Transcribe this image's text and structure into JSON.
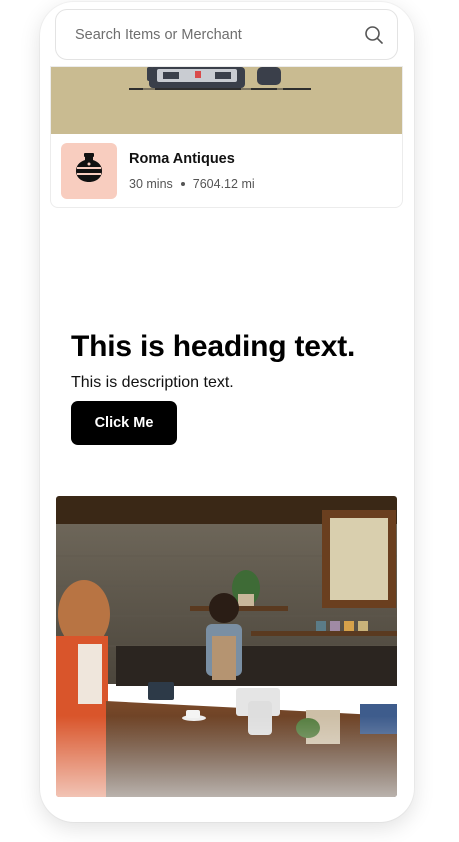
{
  "search": {
    "placeholder": "Search Items or Merchant",
    "icon": "search-icon"
  },
  "merchant": {
    "name": "Roma Antiques",
    "time": "30 mins",
    "distance": "7604.12 mi",
    "icon": "vase-icon",
    "banner_color": "#c9bb91",
    "thumb_color": "#f8cdbf"
  },
  "hero": {
    "heading": "This is heading text.",
    "description": "This is description text.",
    "button_label": "Click Me"
  },
  "colors": {
    "button_bg": "#000000",
    "button_text": "#ffffff"
  }
}
